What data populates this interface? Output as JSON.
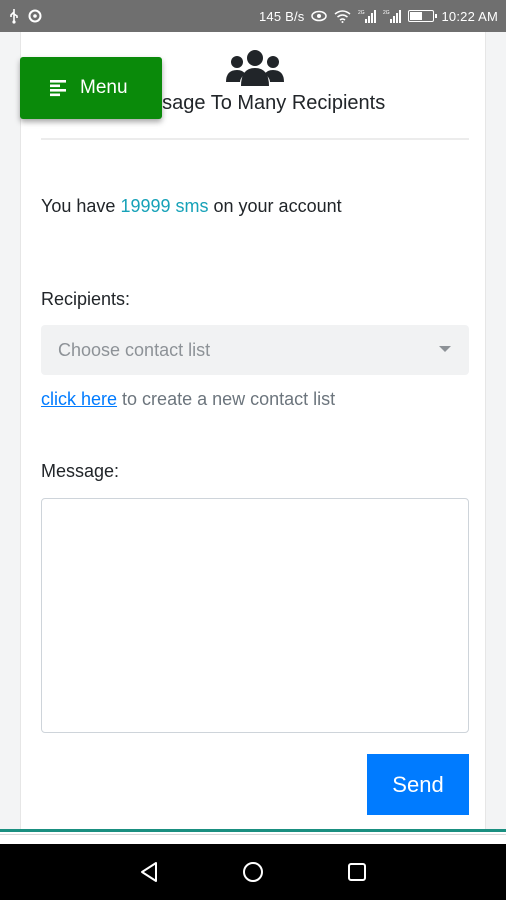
{
  "status_bar": {
    "left_icons": [
      "usb-icon",
      "settings-sync-icon"
    ],
    "speed": "145 B/s",
    "right_icons": [
      "eye-icon",
      "wifi-icon",
      "signal-icon",
      "signal-icon",
      "battery-icon"
    ],
    "signal_1_label": "2G",
    "signal_2_label": "2G",
    "battery_fill_fraction": 0.55,
    "time": "10:22 AM"
  },
  "header": {
    "icon": "users-icon",
    "title": "essage To Many Recipients"
  },
  "menu_button": {
    "label": "Menu",
    "icon": "menu-lines-icon",
    "color": "#0a8a0a"
  },
  "balance": {
    "prefix": "You have",
    "count_text": "19999 sms",
    "suffix": "on your account",
    "accent_color": "#17a2b8"
  },
  "recipients": {
    "label": "Recipients:",
    "select_placeholder": "Choose contact list",
    "helper_link": "click here",
    "helper_text": "to create a new contact list"
  },
  "message": {
    "label": "Message:",
    "value": ""
  },
  "send_button": {
    "label": "Send",
    "color": "#007bff"
  },
  "nav_bar": {
    "buttons": [
      "back-icon",
      "home-icon",
      "recents-icon"
    ]
  }
}
